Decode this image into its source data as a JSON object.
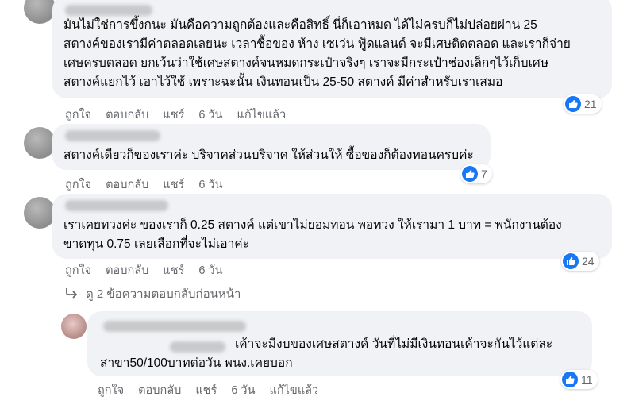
{
  "comments": [
    {
      "text_lines": [
        "มันไม่ใช่การขึ้งกนะ มันคือความถูกต้องและคือสิทธิ์ นี่ก็เอาหมด ได้ไม่ครบก็ไม่ปล่อยผ่าน 25",
        "สตางค์ของเรามีค่าตลอดเลยนะ เวลาซื้อของ ห้าง เซเว่น ฟู้ดแลนด์ จะมีเศษติดตลอด และเราก็จ่าย",
        "เศษครบตลอด ยกเว้นว่าใช้เศษสตางค์จนหมดกระเป๋าจริงๆ เราจะมีกระเป๋าช่องเล็กๆไว้เก็บเศษ",
        "สตางค์แยกไว้ เอาไว้ใช้ เพราะฉะนั้น เงินทอนเป็น 25-50 สตางค์ มีค่าสำหรับเราเสมอ"
      ],
      "like": "ถูกใจ",
      "reply": "ตอบกลับ",
      "share": "แชร์",
      "time": "6 วัน",
      "edited": "แก้ไขแล้ว",
      "reactions": "21"
    },
    {
      "text_lines": [
        "สตางค์เดียวก็ของเราค่ะ บริจาคส่วนบริจาค ให้ส่วนให้ ซื้อของก็ต้องทอนครบค่ะ"
      ],
      "like": "ถูกใจ",
      "reply": "ตอบกลับ",
      "share": "แชร์",
      "time": "6 วัน",
      "reactions": "7"
    },
    {
      "text_lines": [
        "เราเคยทวงค่ะ ของเราก็ 0.25 สตางค์ แต่เขาไม่ยอมทอน พอทวง ให้เรามา 1 บาท = พนักงานต้อง",
        "ขาดทุน 0.75 เลยเลือกที่จะไม่เอาค่ะ"
      ],
      "like": "ถูกใจ",
      "reply": "ตอบกลับ",
      "share": "แชร์",
      "time": "6 วัน",
      "reactions": "24"
    },
    {
      "text_lines": [
        "เค้าจะมีงบของเศษสตางค์ วันที่ไม่มีเงินทอนเค้าจะกันไว้แต่ละ",
        "สาขา50/100บาทต่อวัน พนง.เคยบอก"
      ],
      "like": "ถูกใจ",
      "reply": "ตอบกลับ",
      "share": "แชร์",
      "time": "6 วัน",
      "edited": "แก้ไขแล้ว",
      "reactions": "11"
    }
  ],
  "more_replies": "ดู 2 ข้อความตอบกลับก่อนหน้า",
  "colors": {
    "bubble": "#f0f2f5",
    "muted": "#65676b",
    "like_blue": "#1877f2"
  }
}
